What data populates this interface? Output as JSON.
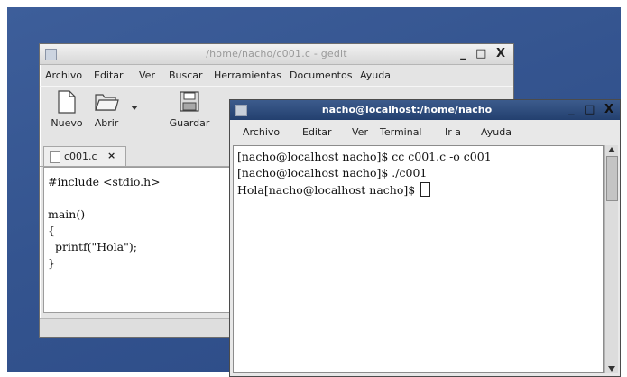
{
  "gedit": {
    "title": "/home/nacho/c001.c - gedit",
    "menu": [
      "Archivo",
      "Editar",
      "Ver",
      "Buscar",
      "Herramientas",
      "Documentos",
      "Ayuda"
    ],
    "toolbar": {
      "new_label": "Nuevo",
      "open_label": "Abrir",
      "save_label": "Guardar"
    },
    "tab": {
      "label": "c001.c",
      "close": "×"
    },
    "code": [
      "#include <stdio.h>",
      "",
      "main()",
      "{",
      "  printf(\"Hola\");",
      "}"
    ]
  },
  "terminal": {
    "title": "nacho@localhost:/home/nacho",
    "menu": [
      "Archivo",
      "Editar",
      "Ver",
      "Terminal",
      "Ir a",
      "Ayuda"
    ],
    "lines": [
      "[nacho@localhost nacho]$ cc c001.c -o c001",
      "[nacho@localhost nacho]$ ./c001",
      "Hola[nacho@localhost nacho]$ "
    ]
  },
  "window_buttons": "_ □ X"
}
